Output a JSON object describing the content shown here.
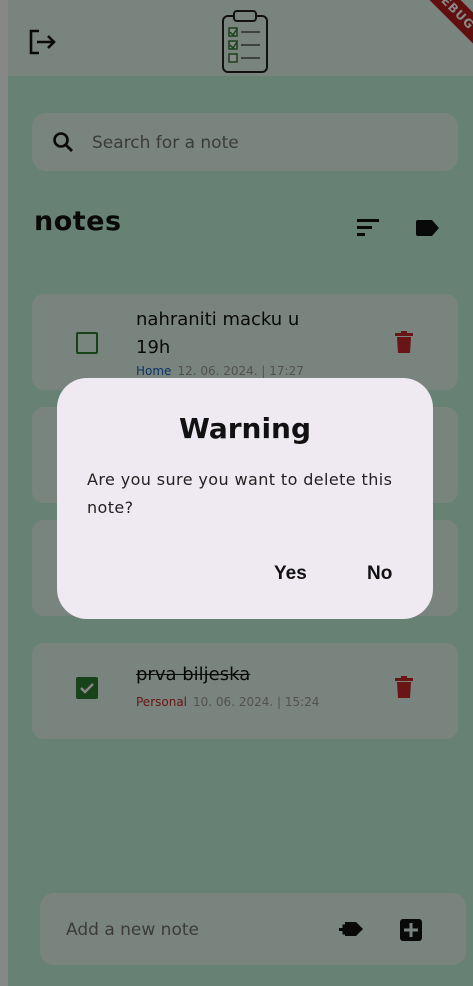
{
  "header": {
    "logout_icon": "logout-icon",
    "logo_icon": "clipboard-checklist-icon",
    "debug_banner": "DEBUG"
  },
  "search": {
    "icon": "search-icon",
    "placeholder": "Search for a note"
  },
  "title": "notes",
  "toolbar": {
    "sort_icon": "sort-icon",
    "labels_icon": "label-icon"
  },
  "notes": [
    {
      "title": "nahraniti macku u 19h",
      "category": "Home",
      "category_color": "#1565c0",
      "datetime": "12. 06. 2024. | 17:27",
      "checked": false
    },
    {
      "title": "",
      "category": "",
      "category_color": "",
      "datetime": "",
      "checked": false
    },
    {
      "title": "",
      "category": "",
      "category_color": "",
      "datetime": "",
      "checked": false
    },
    {
      "title": "prva biljeska",
      "category": "Personal",
      "category_color": "#c62828",
      "datetime": "10. 06. 2024. | 15:24",
      "checked": true
    }
  ],
  "dialog": {
    "title": "Warning",
    "message": "Are you sure you want to delete this note?",
    "yes_label": "Yes",
    "no_label": "No"
  },
  "add_bar": {
    "placeholder": "Add a new note",
    "add_label_icon": "add-label-icon",
    "add_icon": "add-box-icon"
  },
  "colors": {
    "background": "#c2f5dd",
    "card": "#e6f9ef",
    "check": "#2e7d32",
    "trash": "#c62828"
  }
}
